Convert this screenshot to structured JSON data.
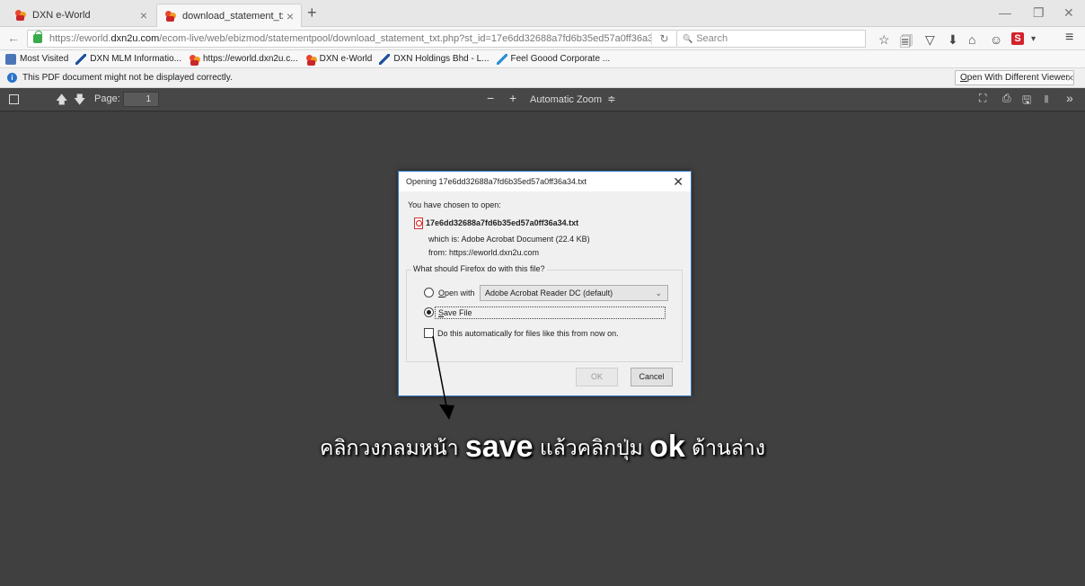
{
  "tabs": [
    {
      "label": "DXN e-World",
      "close": "×"
    },
    {
      "label": "download_statement_txt.p...",
      "close": "×"
    }
  ],
  "new_tab": "+",
  "window_controls": {
    "minimize": "—",
    "restore": "❐",
    "close": "✕"
  },
  "nav": {
    "back": "←",
    "url_prefix": "https://eworld.",
    "url_domain": "dxn2u.com",
    "url_path": "/ecom-live/web/ebizmod/statementpool/download_statement_txt.php?st_id=17e6dd32688a7fd6b35ed57a0ff36a3",
    "reload": "↻",
    "search_placeholder": "Search",
    "search_icon": "🔍"
  },
  "toolbar_icons": [
    "☆",
    "🗐",
    "▽",
    "⬇",
    "⌂",
    "☺",
    "S",
    "▾",
    "≡"
  ],
  "bookmarks": [
    {
      "label": "Most Visited",
      "icon": "grid-icon"
    },
    {
      "label": "DXN MLM Informatio...",
      "icon": "feather-icon"
    },
    {
      "label": "https://eworld.dxn2u.c...",
      "icon": "dxn-icon"
    },
    {
      "label": "DXN e-World",
      "icon": "dxn-icon"
    },
    {
      "label": "DXN Holdings Bhd - L...",
      "icon": "feather-icon"
    },
    {
      "label": "Feel Goood Corporate ...",
      "icon": "feather-icon"
    }
  ],
  "infobar": {
    "message": "This PDF document might not be displayed correctly.",
    "button": "Open With Different Viewer",
    "close": "×"
  },
  "pdf_toolbar": {
    "page_label": "Page:",
    "page_value": "1",
    "zoom_out": "−",
    "zoom_in": "+",
    "zoom_label": "Automatic Zoom",
    "zoom_caret": "≑"
  },
  "dialog": {
    "title": "Opening 17e6dd32688a7fd6b35ed57a0ff36a34.txt",
    "close": "✕",
    "chosen": "You have chosen to open:",
    "filename": "17e6dd32688a7fd6b35ed57a0ff36a34.txt",
    "which_is": "which is:  Adobe Acrobat Document (22.4 KB)",
    "from": "from:  https://eworld.dxn2u.com",
    "question": "What should Firefox do with this file?",
    "open_with_label": "Open with",
    "open_with_app": "Adobe Acrobat Reader DC  (default)",
    "save_file_label": "Save File",
    "auto_label": "Do this automatically for files like this from now on.",
    "ok": "OK",
    "cancel": "Cancel",
    "selected_option": "save_file"
  },
  "annotation": {
    "part1": "คลิกวงกลมหน้า ",
    "word1": "save",
    "part2": " แล้วคลิกปุ่ม ",
    "word2": "ok",
    "part3": " ด้านล่าง"
  }
}
